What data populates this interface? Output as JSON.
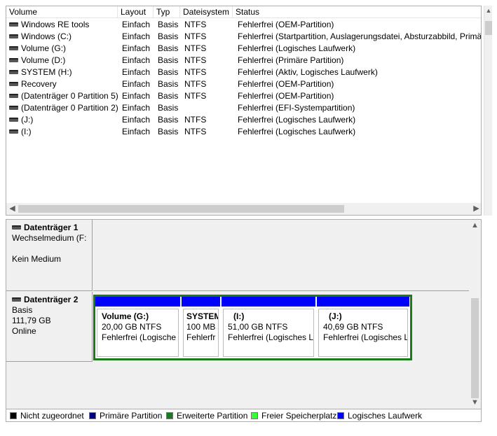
{
  "volume_list": {
    "columns": [
      "Volume",
      "Layout",
      "Typ",
      "Dateisystem",
      "Status"
    ],
    "rows": [
      {
        "volume": "Windows RE tools",
        "layout": "Einfach",
        "typ": "Basis",
        "fs": "NTFS",
        "status": "Fehlerfrei (OEM-Partition)"
      },
      {
        "volume": "Windows (C:)",
        "layout": "Einfach",
        "typ": "Basis",
        "fs": "NTFS",
        "status": "Fehlerfrei (Startpartition, Auslagerungsdatei, Absturzabbild, Primä"
      },
      {
        "volume": "Volume (G:)",
        "layout": "Einfach",
        "typ": "Basis",
        "fs": "NTFS",
        "status": "Fehlerfrei (Logisches Laufwerk)"
      },
      {
        "volume": "Volume (D:)",
        "layout": "Einfach",
        "typ": "Basis",
        "fs": "NTFS",
        "status": "Fehlerfrei (Primäre Partition)"
      },
      {
        "volume": "SYSTEM (H:)",
        "layout": "Einfach",
        "typ": "Basis",
        "fs": "NTFS",
        "status": "Fehlerfrei (Aktiv, Logisches Laufwerk)"
      },
      {
        "volume": "Recovery",
        "layout": "Einfach",
        "typ": "Basis",
        "fs": "NTFS",
        "status": "Fehlerfrei (OEM-Partition)"
      },
      {
        "volume": "(Datenträger 0 Partition 5)",
        "layout": "Einfach",
        "typ": "Basis",
        "fs": "NTFS",
        "status": "Fehlerfrei (OEM-Partition)"
      },
      {
        "volume": "(Datenträger 0 Partition 2)",
        "layout": "Einfach",
        "typ": "Basis",
        "fs": "",
        "status": "Fehlerfrei (EFI-Systempartition)"
      },
      {
        "volume": "(J:)",
        "layout": "Einfach",
        "typ": "Basis",
        "fs": "NTFS",
        "status": "Fehlerfrei (Logisches Laufwerk)"
      },
      {
        "volume": "(I:)",
        "layout": "Einfach",
        "typ": "Basis",
        "fs": "NTFS",
        "status": "Fehlerfrei (Logisches Laufwerk)"
      }
    ]
  },
  "disks": [
    {
      "title": "Datenträger 1",
      "line1": "Wechselmedium (F:",
      "line2": "",
      "line3": "Kein Medium"
    },
    {
      "title": "Datenträger 2",
      "line1": "Basis",
      "line2": "111,79 GB",
      "line3": "Online"
    }
  ],
  "partitions": [
    {
      "name": "Volume  (G:)",
      "size": "20,00 GB NTFS",
      "status": "Fehlerfrei (Logische"
    },
    {
      "name": "SYSTEM",
      "size": "100 MB",
      "status": "Fehlerfr"
    },
    {
      "name": "(I:)",
      "size": "51,00 GB NTFS",
      "status": "Fehlerfrei (Logisches La"
    },
    {
      "name": "(J:)",
      "size": "40,69 GB NTFS",
      "status": "Fehlerfrei (Logisches L"
    }
  ],
  "legend": [
    {
      "label": "Nicht zugeordnet",
      "color": "#000000"
    },
    {
      "label": "Primäre Partition",
      "color": "#00007f"
    },
    {
      "label": "Erweiterte Partition",
      "color": "#1b7a1b"
    },
    {
      "label": "Freier Speicherplatz",
      "color": "#33ff33"
    },
    {
      "label": "Logisches Laufwerk",
      "color": "#0000ff"
    }
  ],
  "icons": {
    "disk": "disk-drive-icon",
    "scroll_left": "◀",
    "scroll_right": "▶",
    "scroll_up": "▲",
    "scroll_down": "▼"
  }
}
